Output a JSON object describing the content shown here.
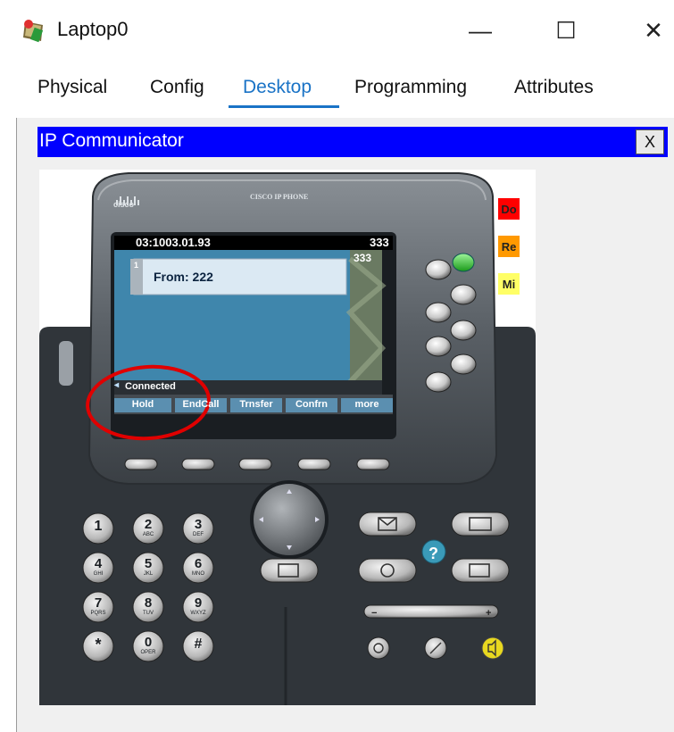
{
  "window": {
    "title": "Laptop0",
    "minimize_glyph": "—",
    "maximize_glyph": "☐",
    "close_glyph": "✕"
  },
  "tabs": [
    {
      "label": "Physical",
      "active": false
    },
    {
      "label": "Config",
      "active": false
    },
    {
      "label": "Desktop",
      "active": true
    },
    {
      "label": "Programming",
      "active": false
    },
    {
      "label": "Attributes",
      "active": false
    }
  ],
  "ip_communicator": {
    "title": "IP Communicator",
    "close_label": "X"
  },
  "phone": {
    "brand_logo": "cisco",
    "model_text": "CISCO IP PHONE",
    "screen": {
      "header_time": "03:1003.01.93",
      "header_line": "333",
      "line_number": "1",
      "call_info": "From: 222",
      "line_button_label": "333",
      "status": "Connected",
      "softkeys": [
        "Hold",
        "EndCall",
        "Trnsfer",
        "Confrn",
        "more"
      ]
    },
    "side_buttons": [
      {
        "label": "Do",
        "color": "#ff0000"
      },
      {
        "label": "Re",
        "color": "#ff9900"
      },
      {
        "label": "Mi",
        "color": "#ffff66"
      }
    ],
    "keypad": [
      {
        "digit": "1",
        "letters": ""
      },
      {
        "digit": "2",
        "letters": "ABC"
      },
      {
        "digit": "3",
        "letters": "DEF"
      },
      {
        "digit": "4",
        "letters": "GHI"
      },
      {
        "digit": "5",
        "letters": "JKL"
      },
      {
        "digit": "6",
        "letters": "MNO"
      },
      {
        "digit": "7",
        "letters": "PQRS"
      },
      {
        "digit": "8",
        "letters": "TUV"
      },
      {
        "digit": "9",
        "letters": "WXYZ"
      },
      {
        "digit": "*",
        "letters": ""
      },
      {
        "digit": "0",
        "letters": "OPER"
      },
      {
        "digit": "#",
        "letters": ""
      }
    ],
    "help_glyph": "?",
    "volume_minus": "−",
    "volume_plus": "+"
  },
  "colors": {
    "accent": "#1a73c6",
    "ip_bar": "#0000ff",
    "annotation": "#e00000",
    "screen_blue": "#4a8fb5"
  }
}
